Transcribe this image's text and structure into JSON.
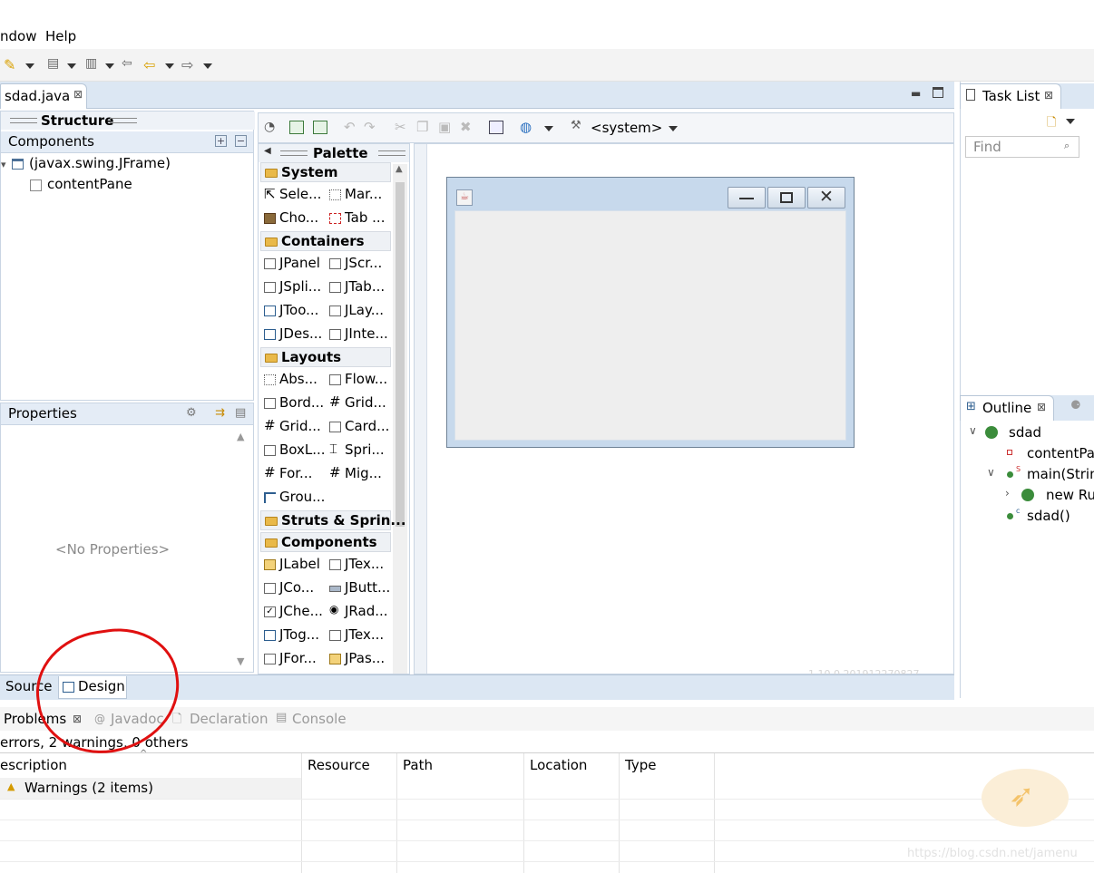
{
  "menu": {
    "window": "ndow",
    "help": "Help"
  },
  "editor": {
    "tab_title": "sdad.java",
    "close": "⊠"
  },
  "structure": {
    "title": "Structure",
    "components_label": "Components",
    "tree": [
      "(javax.swing.JFrame)",
      "contentPane"
    ]
  },
  "properties": {
    "title": "Properties",
    "empty": "<No Properties>"
  },
  "toolbar2": {
    "system_label": "<system>"
  },
  "palette": {
    "title": "Palette",
    "categories": {
      "system": "System",
      "containers": "Containers",
      "layouts": "Layouts",
      "struts": "Struts & Sprin...",
      "components": "Components"
    },
    "system_items": [
      "Sele...",
      "Mar...",
      "Cho...",
      "Tab ..."
    ],
    "container_items": [
      "JPanel",
      "JScr...",
      "JSpli...",
      "JTab...",
      "JToo...",
      "JLay...",
      "JDes...",
      "JInte..."
    ],
    "layout_items": [
      "Abs...",
      "Flow...",
      "Bord...",
      "Grid...",
      "Grid...",
      "Card...",
      "BoxL...",
      "Spri...",
      "For...",
      "Mig...",
      "Grou..."
    ],
    "component_items": [
      "JLabel",
      "JTex...",
      "JCo...",
      "JButt...",
      "JChe...",
      "JRad...",
      "JTog...",
      "JTex...",
      "JFor...",
      "JPas..."
    ]
  },
  "canvas": {
    "version_text": "1.10.0.201912270827"
  },
  "bottom_tabs": {
    "source": "Source",
    "design": "Design"
  },
  "problems": {
    "tabs": [
      "Problems",
      "Javadoc",
      "Declaration",
      "Console"
    ],
    "summary": "errors, 2 warnings, 0 others",
    "columns": [
      "escription",
      "Resource",
      "Path",
      "Location",
      "Type"
    ],
    "rows": [
      "Warnings (2 items)"
    ]
  },
  "task_list": {
    "title": "Task List",
    "find_placeholder": "Find"
  },
  "outline": {
    "title": "Outline",
    "items": [
      "sdad",
      "contentPa",
      "main(Strin",
      "new Ru",
      "sdad()"
    ]
  },
  "watermark": "https://blog.csdn.net/jamenu"
}
